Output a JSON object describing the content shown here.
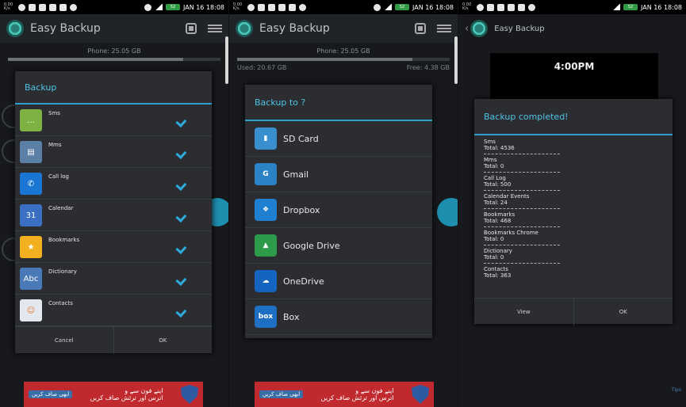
{
  "status": {
    "time": "JAN 16 18:08",
    "speed": "0.00 K/s",
    "battery": "52"
  },
  "app": {
    "title": "Easy Backup"
  },
  "storage": {
    "phone": "Phone: 25.05 GB",
    "used": "Used: 20.67 GB",
    "free": "Free: 4.38 GB",
    "used_fraction": 0.825
  },
  "backup_dialog": {
    "title": "Backup",
    "items": [
      {
        "label": "Sms",
        "icon": "sms-icon",
        "color": "#7cb342",
        "glyph": "…",
        "checked": true
      },
      {
        "label": "Mms",
        "icon": "mms-icon",
        "color": "#5c7fa8",
        "glyph": "▤",
        "checked": true
      },
      {
        "label": "Call log",
        "icon": "call-log-icon",
        "color": "#1976d2",
        "glyph": "✆",
        "checked": true
      },
      {
        "label": "Calendar",
        "icon": "calendar-icon",
        "color": "#3a6fc4",
        "glyph": "31",
        "checked": true
      },
      {
        "label": "Bookmarks",
        "icon": "bookmarks-icon",
        "color": "#f2b01e",
        "glyph": "★",
        "checked": true
      },
      {
        "label": "Dictionary",
        "icon": "dictionary-icon",
        "color": "#4a79b8",
        "glyph": "Abc",
        "checked": true
      },
      {
        "label": "Contacts",
        "icon": "contacts-icon",
        "color": "#e3e8ee",
        "glyph": "☺",
        "checked": true
      }
    ],
    "cancel": "Cancel",
    "ok": "OK"
  },
  "destination_dialog": {
    "title": "Backup to ?",
    "items": [
      {
        "label": "SD Card",
        "icon": "sd-card-icon",
        "color": "#3a8fd1",
        "glyph": "▮"
      },
      {
        "label": "Gmail",
        "icon": "gmail-icon",
        "color": "#2b83c6",
        "glyph": "G"
      },
      {
        "label": "Dropbox",
        "icon": "dropbox-icon",
        "color": "#1f7fd0",
        "glyph": "❖"
      },
      {
        "label": "Google Drive",
        "icon": "google-drive-icon",
        "color": "#2e9b4b",
        "glyph": "▲"
      },
      {
        "label": "OneDrive",
        "icon": "onedrive-icon",
        "color": "#1565c0",
        "glyph": "☁"
      },
      {
        "label": "Box",
        "icon": "box-icon",
        "color": "#1e6fc2",
        "glyph": "box"
      }
    ]
  },
  "result_dialog": {
    "title": "Backup completed!",
    "items": [
      {
        "label": "Sms",
        "total": "Total: 4536"
      },
      {
        "label": "Mms",
        "total": "Total: 0"
      },
      {
        "label": "Call Log",
        "total": "Total: 500"
      },
      {
        "label": "Calendar Events",
        "total": "Total: 24"
      },
      {
        "label": "Bookmarks",
        "total": "Total: 468"
      },
      {
        "label": "Bookmarks Chrome",
        "total": "Total: 0"
      },
      {
        "label": "Dictionary",
        "total": "Total: 0"
      },
      {
        "label": "Contacts",
        "total": "Total: 363"
      }
    ],
    "view": "View",
    "ok": "OK"
  },
  "lock_preview": {
    "time": "4:00PM"
  },
  "ad": {
    "line1": "اپنے فون سے و",
    "line2": "اترس اور ترئش صاف کریں",
    "button": "ابھی صاف کریں"
  },
  "hint": "Tips"
}
